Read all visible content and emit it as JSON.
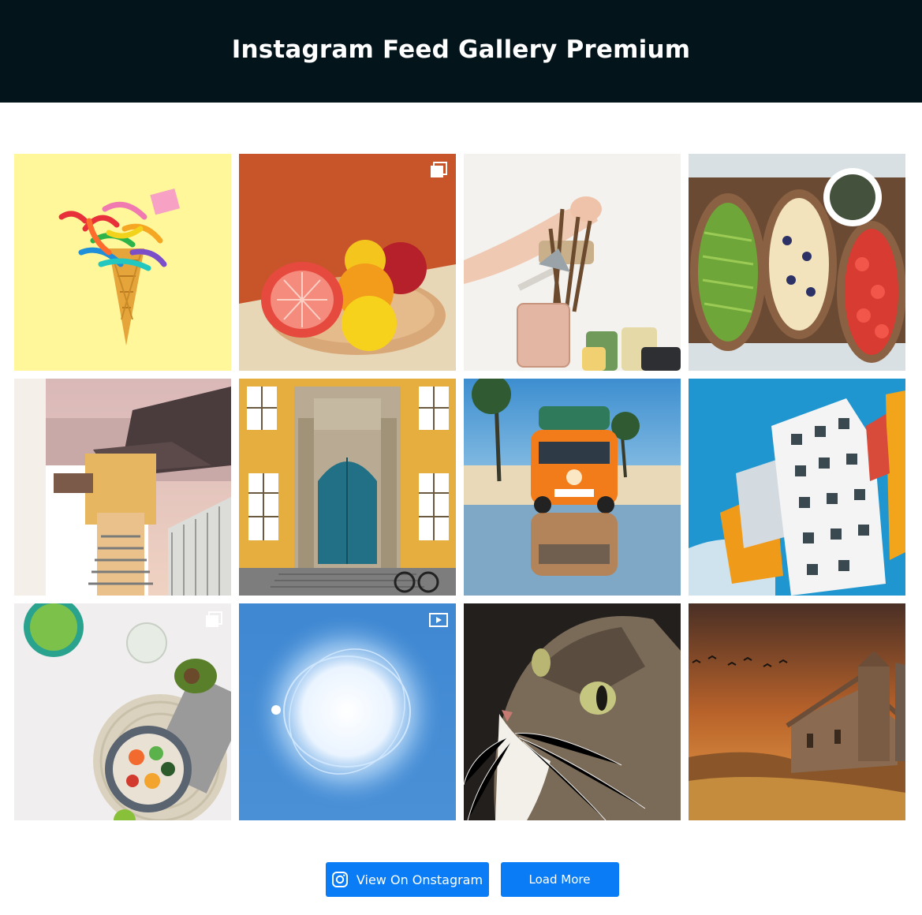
{
  "header": {
    "title": "Instagram Feed Gallery Premium",
    "bg_color": "#04141b"
  },
  "gallery": {
    "posts": [
      {
        "subject": "confetti ice cream cone",
        "badge": "none"
      },
      {
        "subject": "fruit bowl with grapefruit and lemons",
        "badge": "carousel"
      },
      {
        "subject": "hand holding paint brushes",
        "badge": "none"
      },
      {
        "subject": "avocado toast",
        "badge": "none"
      },
      {
        "subject": "santorini stairs by the sea",
        "badge": "none"
      },
      {
        "subject": "baroque doorway with yellow facade",
        "badge": "none"
      },
      {
        "subject": "orange vw van with surfboards",
        "badge": "none"
      },
      {
        "subject": "modern deconstructivist building",
        "badge": "none"
      },
      {
        "subject": "salad bowl on table",
        "badge": "carousel"
      },
      {
        "subject": "glowing light orb",
        "badge": "video"
      },
      {
        "subject": "tabby cat close-up",
        "badge": "none"
      },
      {
        "subject": "stone church at sunset",
        "badge": "none"
      }
    ]
  },
  "actions": {
    "view_label": "View On Onstagram",
    "load_more_label": "Load More",
    "view_icon": "instagram-icon",
    "button_color": "#0a7cf5"
  }
}
